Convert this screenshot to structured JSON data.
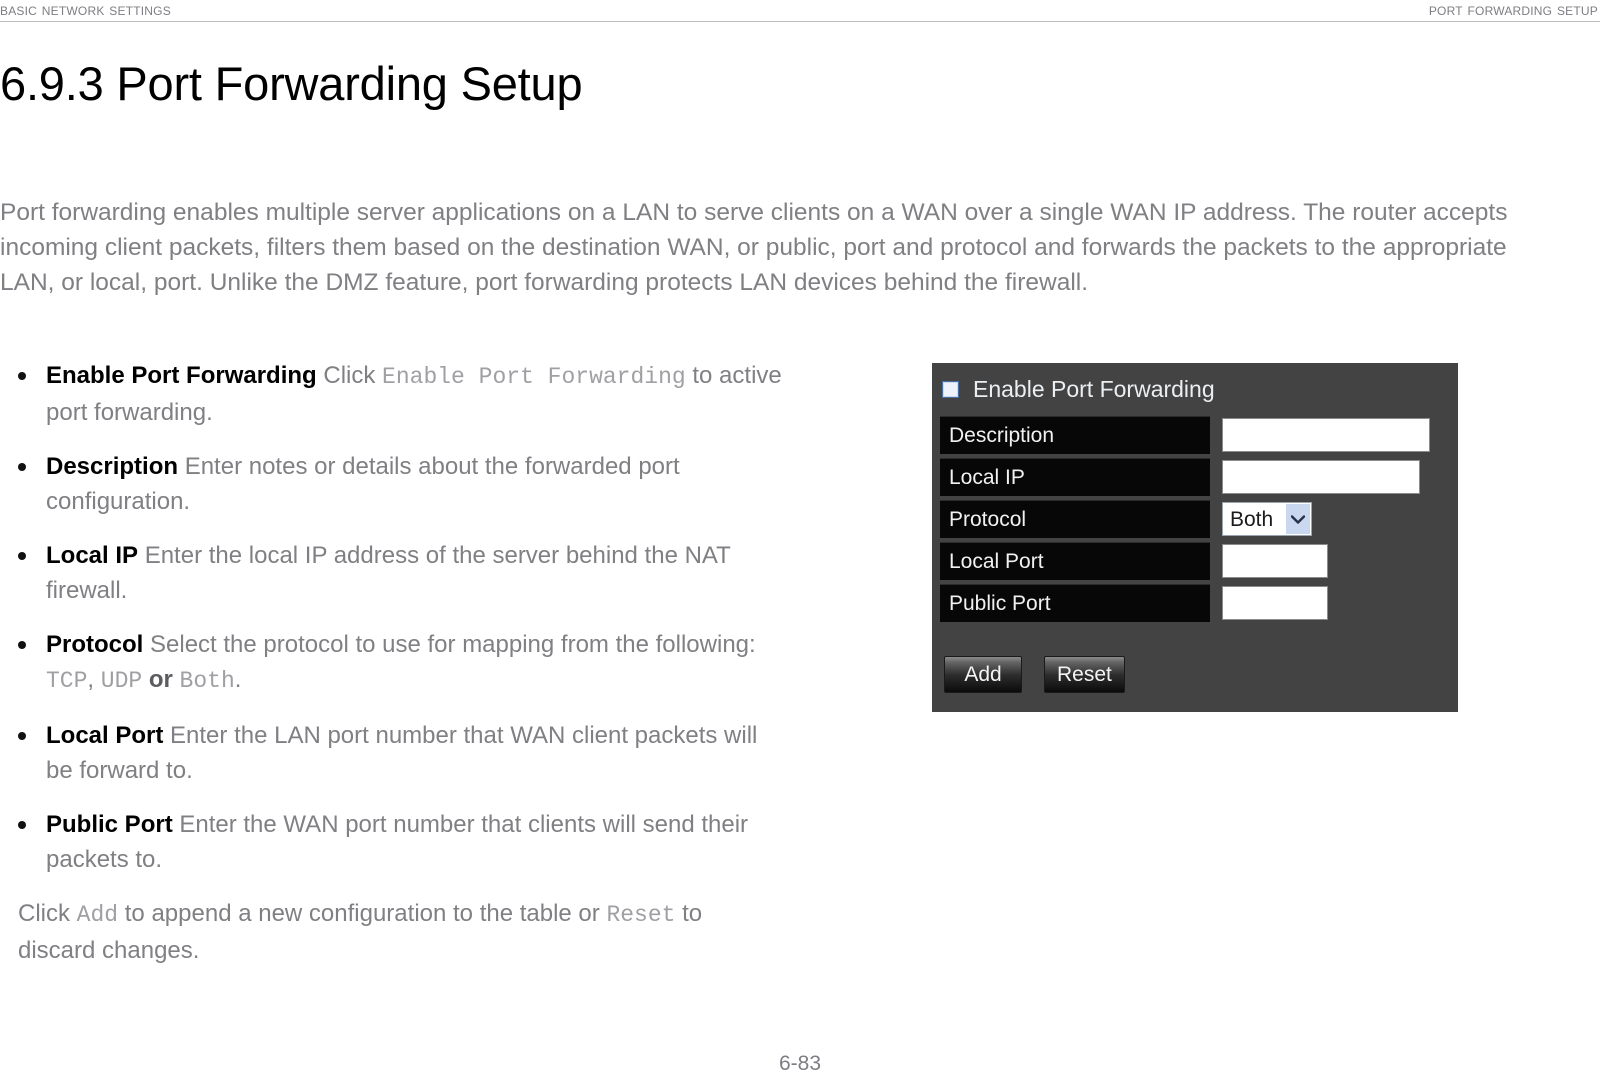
{
  "header": {
    "left": "Basic Network Settings",
    "right": "Port Forwarding Setup"
  },
  "title": "6.9.3 Port Forwarding Setup",
  "intro": "Port forwarding enables multiple server applications on a LAN to serve clients on a WAN over a single WAN IP address. The router accepts incoming client packets, filters them based on the destination WAN, or public, port and protocol and forwards the packets to the appropriate LAN, or local, port. Unlike the DMZ feature, port forwarding protects LAN devices behind the firewall.",
  "bullets": [
    {
      "term": "Enable Port Forwarding",
      "text_before": "Click",
      "mono": "Enable Port Forwarding",
      "text_after": "to active port forwarding."
    },
    {
      "term": "Description",
      "text_before": "Enter notes or details about the forwarded port configuration.",
      "mono": "",
      "text_after": ""
    },
    {
      "term": "Local IP",
      "text_before": "Enter the local IP address of the server behind the NAT firewall.",
      "mono": "",
      "text_after": ""
    },
    {
      "term": "Protocol",
      "text_before": "Select the protocol to use for mapping from the following:",
      "mono": "TCP",
      "mono2": "UDP",
      "mono3": "Both",
      "joiner": "or",
      "text_after": "."
    },
    {
      "term": "Local Port",
      "text_before": "Enter the LAN port number that WAN client packets will be forward to.",
      "mono": "",
      "text_after": ""
    },
    {
      "term": "Public Port",
      "text_before": "Enter the WAN port number that clients will send their packets to.",
      "mono": "",
      "text_after": ""
    }
  ],
  "closing": {
    "part1": "Click",
    "mono1": "Add",
    "part2": "to append a new configuration to the table or",
    "mono2": "Reset",
    "part3": "to discard changes."
  },
  "screenshot": {
    "enable_checkbox_label": "Enable Port Forwarding",
    "enable_checkbox_checked": false,
    "rows": [
      {
        "label": "Description",
        "control": "text",
        "value": ""
      },
      {
        "label": "Local IP",
        "control": "text",
        "value": ""
      },
      {
        "label": "Protocol",
        "control": "select",
        "value": "Both"
      },
      {
        "label": "Local Port",
        "control": "text",
        "value": ""
      },
      {
        "label": "Public Port",
        "control": "text",
        "value": ""
      }
    ],
    "buttons": [
      {
        "label": "Add"
      },
      {
        "label": "Reset"
      }
    ],
    "colors": {
      "panel_bg": "#434343",
      "label_bg": "#070707",
      "label_text": "#f1f1f1",
      "select_arrow_bg": "#c9d8ef"
    }
  },
  "footer": {
    "page": "6-83"
  }
}
